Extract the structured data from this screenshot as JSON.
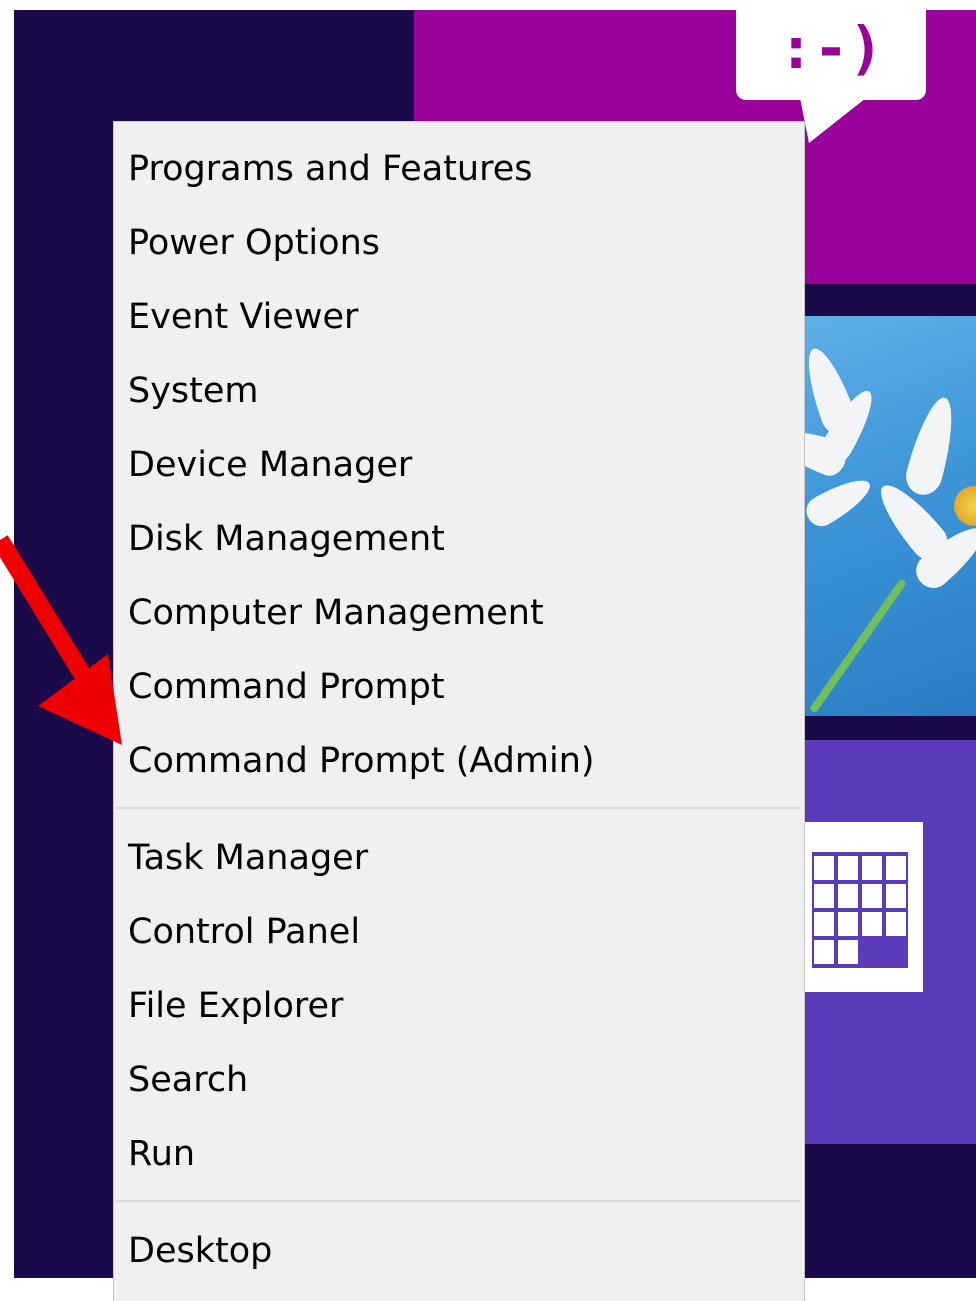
{
  "start_screen": {
    "messaging_tile": {
      "emoticon": ":-)",
      "color": "#9a009a"
    },
    "calendar_tile": {
      "color": "#5b3bb9"
    },
    "background_color": "#1a0a4a"
  },
  "power_user_menu": {
    "items": [
      {
        "label": "Programs and Features"
      },
      {
        "label": "Power Options"
      },
      {
        "label": "Event Viewer"
      },
      {
        "label": "System"
      },
      {
        "label": "Device Manager"
      },
      {
        "label": "Disk Management"
      },
      {
        "label": "Computer Management"
      },
      {
        "label": "Command Prompt"
      },
      {
        "label": "Command Prompt (Admin)"
      },
      {
        "label": "Task Manager"
      },
      {
        "label": "Control Panel"
      },
      {
        "label": "File Explorer"
      },
      {
        "label": "Search"
      },
      {
        "label": "Run"
      },
      {
        "label": "Desktop"
      }
    ]
  },
  "annotation": {
    "arrow_color": "#ee0000",
    "target": "Command Prompt (Admin)"
  }
}
